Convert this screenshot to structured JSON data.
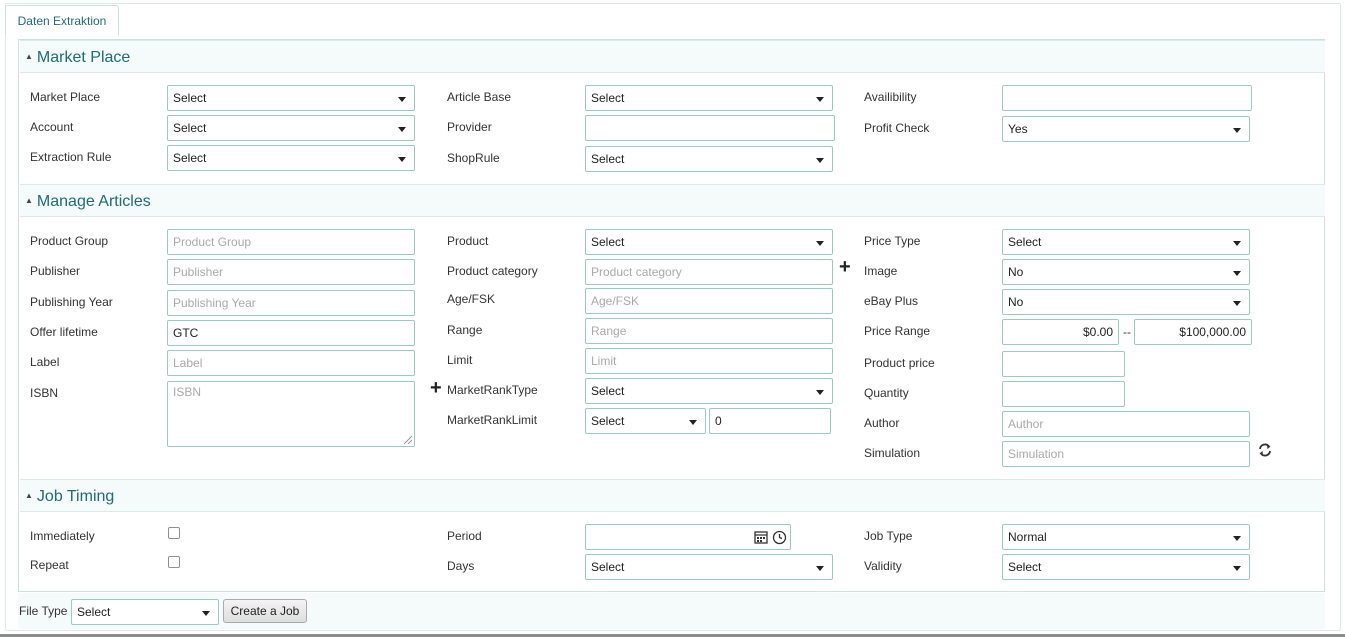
{
  "tab": {
    "label": "Daten Extraktion"
  },
  "market_place": {
    "title": "Market Place",
    "market_place_label": "Market Place",
    "market_place_value": "Select",
    "account_label": "Account",
    "account_value": "Select",
    "extraction_rule_label": "Extraction Rule",
    "extraction_rule_value": "Select",
    "article_base_label": "Article Base",
    "article_base_value": "Select",
    "provider_label": "Provider",
    "provider_value": "",
    "shop_rule_label": "ShopRule",
    "shop_rule_value": "Select",
    "availability_label": "Availibility",
    "availability_value": "",
    "profit_check_label": "Profit Check",
    "profit_check_value": "Yes"
  },
  "manage_articles": {
    "title": "Manage Articles",
    "product_group_label": "Product Group",
    "product_group_placeholder": "Product Group",
    "publisher_label": "Publisher",
    "publisher_placeholder": "Publisher",
    "publishing_year_label": "Publishing Year",
    "publishing_year_placeholder": "Publishing Year",
    "offer_lifetime_label": "Offer lifetime",
    "offer_lifetime_value": "GTC",
    "label_label": "Label",
    "label_placeholder": "Label",
    "isbn_label": "ISBN",
    "isbn_placeholder": "ISBN",
    "product_label": "Product",
    "product_value": "Select",
    "product_category_label": "Product category",
    "product_category_placeholder": "Product category",
    "age_fsk_label": "Age/FSK",
    "age_fsk_placeholder": "Age/FSK",
    "range_label": "Range",
    "range_placeholder": "Range",
    "limit_label": "Limit",
    "limit_placeholder": "Limit",
    "market_rank_type_label": "MarketRankType",
    "market_rank_type_value": "Select",
    "market_rank_limit_label": "MarketRankLimit",
    "market_rank_limit_select": "Select",
    "market_rank_limit_value": "0",
    "price_type_label": "Price Type",
    "price_type_value": "Select",
    "image_label": "Image",
    "image_value": "No",
    "ebay_plus_label": "eBay Plus",
    "ebay_plus_value": "No",
    "price_range_label": "Price Range",
    "price_range_min": "$0.00",
    "price_range_sep": "--",
    "price_range_max": "$100,000.00",
    "product_price_label": "Product price",
    "product_price_value": "",
    "quantity_label": "Quantity",
    "quantity_value": "",
    "author_label": "Author",
    "author_placeholder": "Author",
    "simulation_label": "Simulation",
    "simulation_placeholder": "Simulation"
  },
  "job_timing": {
    "title": "Job Timing",
    "immediately_label": "Immediately",
    "repeat_label": "Repeat",
    "period_label": "Period",
    "period_value": "",
    "days_label": "Days",
    "days_value": "Select",
    "job_type_label": "Job Type",
    "job_type_value": "Normal",
    "validity_label": "Validity",
    "validity_value": "Select"
  },
  "footer": {
    "file_type_label": "File Type",
    "file_type_value": "Select",
    "create_job_label": "Create a Job"
  }
}
